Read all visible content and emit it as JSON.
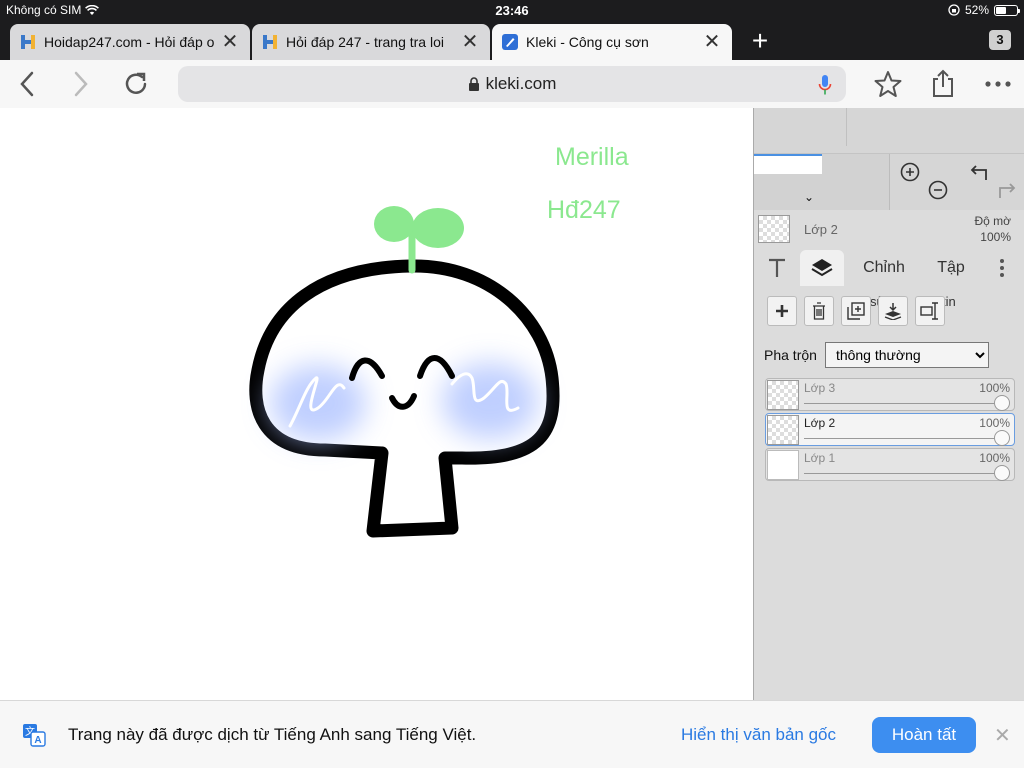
{
  "status": {
    "carrier": "Không có SIM",
    "time": "23:46",
    "battery": "52%",
    "battery_level": 0.52
  },
  "tabs": [
    {
      "title": "Hoidap247.com - Hỏi đáp o",
      "favicon": "hoidap-logo-icon"
    },
    {
      "title": "Hỏi đáp 247 - trang tra loi",
      "favicon": "hoidap-logo-icon"
    },
    {
      "title": "Kleki - Công cụ sơn",
      "favicon": "kleki-logo-icon",
      "active": true
    }
  ],
  "tab_count": "3",
  "url": "kleki.com",
  "canvas": {
    "text1": "Merilla",
    "text2": "Hđ247",
    "text_color": "#8be88f"
  },
  "panel": {
    "current_layer": {
      "name": "Lớp 2",
      "opacity_label": "Độ mờ",
      "opacity": "100%"
    },
    "tab_chinh": "Chỉnh",
    "tab_chinh_sub": "sửa",
    "tab_tap": "Tập",
    "tab_tap_sub": "tin",
    "blend_label": "Pha trộn",
    "blend_value": "thông thường",
    "layers": [
      {
        "name": "Lớp 3",
        "opacity": "100%",
        "opacity_value": 1.0
      },
      {
        "name": "Lớp 2",
        "opacity": "100%",
        "opacity_value": 1.0,
        "selected": true
      },
      {
        "name": "Lớp 1",
        "opacity": "100%",
        "opacity_value": 1.0
      }
    ]
  },
  "translate_bar": {
    "message": "Trang này đã được dịch từ Tiếng Anh sang Tiếng Việt.",
    "show_original": "Hiển thị văn bản gốc",
    "done": "Hoàn tất"
  },
  "colors": {
    "accent": "#3d8ef0",
    "link": "#2a7ae2",
    "status_bg": "#1c1c1e"
  }
}
